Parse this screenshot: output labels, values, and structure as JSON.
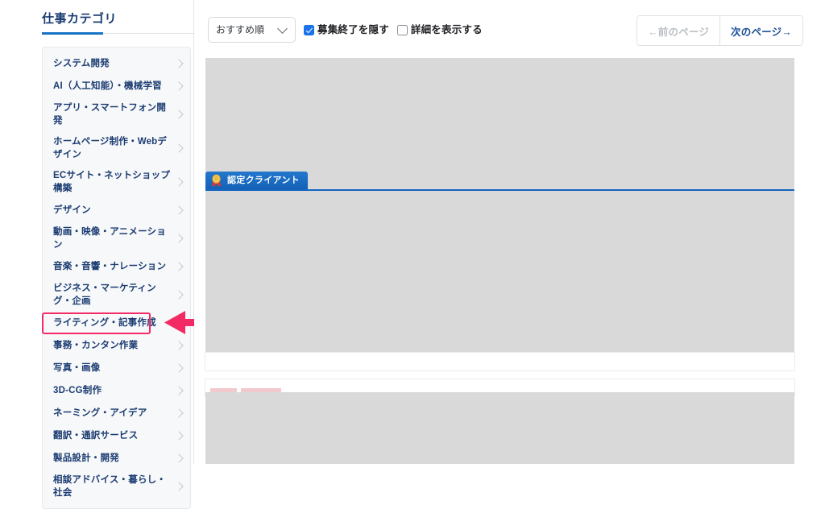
{
  "sidebar": {
    "title": "仕事カテゴリ",
    "accent_color": "#1773c4",
    "text_color": "#1b3c72",
    "panel_bg": "#f7f8f9",
    "items": [
      {
        "label": "システム開発",
        "chevron": "chevron-right-icon",
        "highlighted": false
      },
      {
        "label": "AI（人工知能）・機械学習",
        "chevron": "chevron-right-icon",
        "highlighted": false
      },
      {
        "label": "アプリ・スマートフォン開発",
        "chevron": "chevron-right-icon",
        "highlighted": false
      },
      {
        "label": "ホームページ制作・Webデザイン",
        "chevron": "chevron-right-icon",
        "highlighted": false
      },
      {
        "label": "ECサイト・ネットショップ構築",
        "chevron": "chevron-right-icon",
        "highlighted": false
      },
      {
        "label": "デザイン",
        "chevron": "chevron-right-icon",
        "highlighted": false
      },
      {
        "label": "動画・映像・アニメーション",
        "chevron": "chevron-right-icon",
        "highlighted": false
      },
      {
        "label": "音楽・音響・ナレーション",
        "chevron": "chevron-right-icon",
        "highlighted": false
      },
      {
        "label": "ビジネス・マーケティング・企画",
        "chevron": "chevron-right-icon",
        "highlighted": false
      },
      {
        "label": "ライティング・記事作成",
        "chevron": "chevron-right-icon",
        "highlighted": true
      },
      {
        "label": "事務・カンタン作業",
        "chevron": "chevron-right-icon",
        "highlighted": false
      },
      {
        "label": "写真・画像",
        "chevron": "chevron-right-icon",
        "highlighted": false
      },
      {
        "label": "3D-CG制作",
        "chevron": "chevron-right-icon",
        "highlighted": false
      },
      {
        "label": "ネーミング・アイデア",
        "chevron": "chevron-right-icon",
        "highlighted": false
      },
      {
        "label": "翻訳・通訳サービス",
        "chevron": "chevron-right-icon",
        "highlighted": false
      },
      {
        "label": "製品設計・開発",
        "chevron": "chevron-right-icon",
        "highlighted": false
      },
      {
        "label": "相談アドバイス・暮らし・社会",
        "chevron": "chevron-right-icon",
        "highlighted": false
      }
    ]
  },
  "annotation": {
    "color": "#f32a63",
    "target_label": "ライティング・記事作成",
    "arrow": "left-arrow-annotation"
  },
  "toolbar": {
    "sort_select": {
      "value": "おすすめ順",
      "chevron": "chevron-down-icon"
    },
    "checkboxes": [
      {
        "label": "募集終了を隠す",
        "checked": true
      },
      {
        "label": "詳細を表示する",
        "checked": false
      }
    ],
    "checked_color": "#1a73e8"
  },
  "pagination": {
    "prev_label": "←前のページ",
    "next_label": "次のページ→",
    "prev_disabled": true,
    "next_color": "#1a4f97",
    "disabled_color": "#bcc0c4"
  },
  "content": {
    "certified_tab": {
      "label": "認定クライアント",
      "icon": "gold-medal-icon",
      "bg_color": "#1565c0"
    },
    "skeleton_color": "#d9d9d9",
    "badge_placeholder_color": "#f2c9cd"
  }
}
